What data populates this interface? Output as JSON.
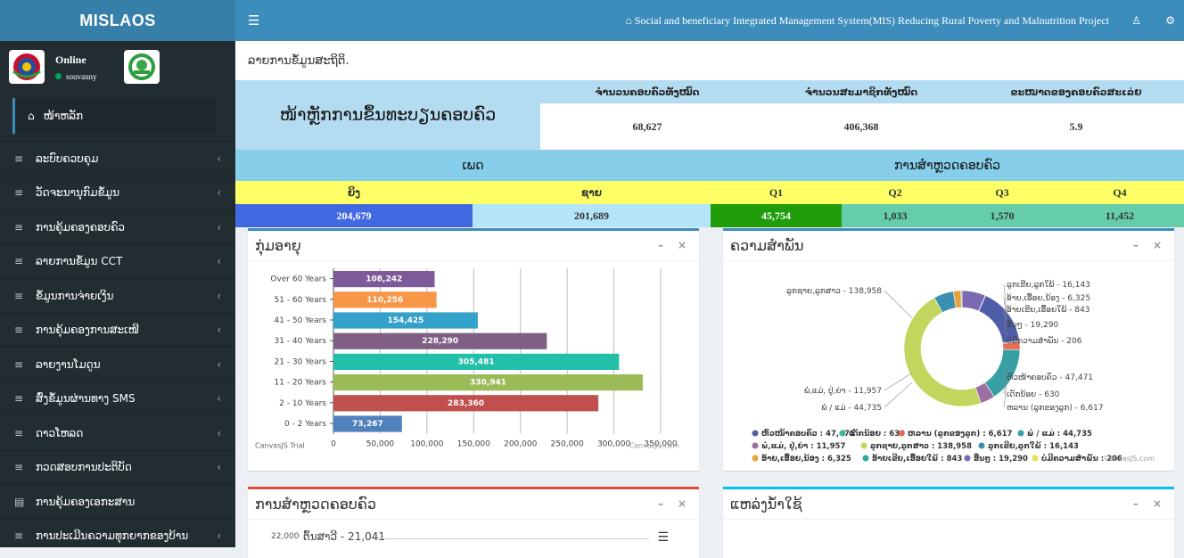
{
  "app": {
    "name": "MISLAOS",
    "title": "Social and beneficiary Integrated Management System(MIS) Reducing Rural Poverty and Malnutrition Project"
  },
  "user": {
    "status": "Online",
    "username": "souvanny"
  },
  "sidebar": {
    "active": "ໜ້າຫລັກ",
    "items": [
      {
        "label": "ລະບົບຄວບຄຸມ",
        "icon": "list-icon"
      },
      {
        "label": "ວັດຈະນານຸກົມຂໍ້ມູນ",
        "icon": "list-icon"
      },
      {
        "label": "ການຄຸ້ມຄອງຄອບຄົວ",
        "icon": "list-icon"
      },
      {
        "label": "ລາຍການຂໍ້ມູນ CCT",
        "icon": "list-icon"
      },
      {
        "label": "ຂໍ້ມູນການຈ່າຍເງິນ",
        "icon": "list-icon"
      },
      {
        "label": "ການຄຸ້ມຄອງການສະເໜີ",
        "icon": "list-icon"
      },
      {
        "label": "ລາຍງານໂມດູນ",
        "icon": "list-icon"
      },
      {
        "label": "ສົ່ງຂໍ້ມູນຜ່ານທາງ SMS",
        "icon": "list-icon"
      },
      {
        "label": "ດາວໂຫລດ",
        "icon": "list-icon"
      },
      {
        "label": "ກວດສອບການປະຕິບັດ",
        "icon": "list-icon"
      },
      {
        "label": "ການຄຸ້ມຄອງເອກະສານ",
        "icon": "file-icon"
      },
      {
        "label": "ການປະເມີນຄວາມທຸກຍາກຂອງບ້ານ",
        "icon": "list-icon"
      }
    ]
  },
  "page": {
    "heading": "ລາຍການຂໍ້ມູນສະຖິຕິ."
  },
  "summary": {
    "title": "ໜ້າຫຼັກການຂຶ້ນທະບຽນຄອບຄົວ",
    "headers": [
      "ຈຳນວນຄອບຄົວທັງໝົດ",
      "ຈຳນວນສະມາຊິກທັງໝົດ",
      "ຂະໜາດຂອງຄອບຄົວສະເລ່ຍ"
    ],
    "values": [
      "68,627",
      "406,368",
      "5.9"
    ]
  },
  "gender": {
    "title": "ເພດ",
    "labels": [
      "ຍິງ",
      "ຊາຍ"
    ],
    "values": [
      "204,679",
      "201,689"
    ]
  },
  "survey": {
    "title": "ການສຳຫຼວດຄອບຄົວ",
    "labels": [
      "Q1",
      "Q2",
      "Q3",
      "Q4"
    ],
    "values": [
      "45,754",
      "1,033",
      "1,570",
      "11,452"
    ]
  },
  "colors": {
    "female": "#4169e1",
    "male": "#b4e4f8",
    "q1": "#1f9d0a",
    "q2_q4": "#66cdaa"
  },
  "panels": {
    "age": {
      "title": "ກຸ່ມອາຍຸ",
      "trial": "CanvasJS Trial",
      "credit": "CanvasJS.com"
    },
    "relation": {
      "title": "ຄວາມສຳພັນ",
      "credit": "CanvasJS.com"
    },
    "survey2": {
      "title": "ການສຳຫຼວດຄອບຄົວ",
      "y_tick": "22,000",
      "label": "ຕົ້ນສາວີ - 21,041"
    },
    "water": {
      "title": "ແຫລ່ງນ້ຳໃຊ້"
    }
  },
  "chart_data": [
    {
      "type": "bar",
      "orientation": "horizontal",
      "categories": [
        "Over 60 Years",
        "51 - 60 Years",
        "41 - 50 Years",
        "31 - 40 Years",
        "21 - 30 Years",
        "11 - 20 Years",
        "2 - 10 Years",
        "0 - 2 Years"
      ],
      "values": [
        108242,
        110256,
        154425,
        228290,
        305481,
        330941,
        283360,
        73267
      ],
      "value_labels": [
        "108,242",
        "110,256",
        "154,425",
        "228,290",
        "305,481",
        "330,941",
        "283,360",
        "73,267"
      ],
      "colors": [
        "#7e5a9b",
        "#f79647",
        "#33a1c9",
        "#7f6084",
        "#22c0a8",
        "#9bbb59",
        "#c0504d",
        "#4f81bc"
      ],
      "xlim": [
        0,
        350000
      ],
      "x_ticks": [
        "0",
        "50,000",
        "100,000",
        "150,000",
        "200,000",
        "250,000",
        "300,000",
        "350,000"
      ]
    },
    {
      "type": "pie",
      "donut": true,
      "slices": [
        {
          "label": "ຫົວໜ້າຄອບຄົວ",
          "value": 47471,
          "color": "#4f5ea8"
        },
        {
          "label": "ເດັກນ້ອຍ",
          "value": 630,
          "color": "#3cba9f"
        },
        {
          "label": "ຫລານ (ລູກຂອງລູກ)",
          "value": 6617,
          "color": "#e96b55"
        },
        {
          "label": "ພໍ່ / ແມ່",
          "value": 44735,
          "color": "#38a0a5"
        },
        {
          "label": "ພໍ່,ແມ່, ປູ່,ຍ່າ",
          "value": 11957,
          "color": "#9c6fa3"
        },
        {
          "label": "ລູກຊາຍ,ລູກສາວ",
          "value": 138958,
          "color": "#c2d65e"
        },
        {
          "label": "ລູກເຂີຍ,ລູກໃພ້",
          "value": 16143,
          "color": "#3d8fb0"
        },
        {
          "label": "ອ້າຍ,ເອື້ອຍ,ນ້ອງ",
          "value": 6325,
          "color": "#e6a23c"
        },
        {
          "label": "ອ້າຍເຂີຍ,ເອື້ອຍໃພ້",
          "value": 843,
          "color": "#2eaa9a"
        },
        {
          "label": "ອື່ນໆ",
          "value": 19290,
          "color": "#7b6ab2"
        },
        {
          "label": "ບໍ່ມີຄວາມສຳພັນ",
          "value": 206,
          "color": "#e3e04f"
        }
      ],
      "labels": [
        "ລູກຊາຍ,ລູກສາວ - 138,958",
        "ລູກເຂີຍ,ລູກໃພ້ - 16,143",
        "ອ້າຍ,ເອື້ອຍ,ນ້ອງ - 6,325",
        "ອ້າຍເຂີຍ,ເອື້ອຍໃພ້ - 843",
        "ອື່ນໆ - 19,290",
        "ບໍ່ມີຄວາມສຳພັນ - 206",
        "ຫົວໜ້າຄອບຄົວ - 47,471",
        "ເດັກນ້ອຍ - 630",
        "ຫລານ (ລູກຂອງລູກ) - 6,617",
        "ພໍ່ / ແມ່ - 44,735",
        "ພໍ່,ແມ່, ປູ່,ຍ່າ - 11,957"
      ],
      "legend": [
        "ຫົວໜ້າຄອບຄົວ : 47,471",
        "ເດັກນ້ອຍ : 630",
        "ຫລານ (ລູກຂອງລູກ) : 6,617",
        "ພໍ່ / ແມ່ : 44,735",
        "ພໍ່,ແມ່, ປູ່,ຍ່າ : 11,957",
        "ລູກຊາຍ,ລູກສາວ : 138,958",
        "ລູກເຂີຍ,ລູກໃພ້ : 16,143",
        "ອ້າຍ,ເອື້ອຍ,ນ້ອງ : 6,325",
        "ອ້າຍເຂີຍ,ເອື້ອຍໃພ້ : 843",
        "ອື່ນໆ : 19,290",
        "ບໍ່ມີຄວາມສຳພັນ : 206"
      ]
    }
  ]
}
